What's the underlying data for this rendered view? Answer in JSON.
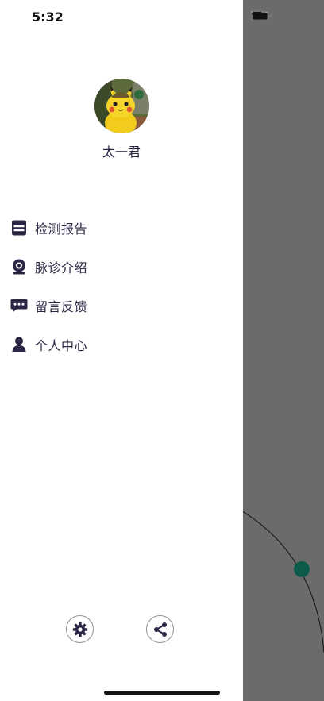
{
  "status_bar": {
    "time": "5:32"
  },
  "profile": {
    "username": "太一君",
    "avatar_icon": "pikachu-avatar"
  },
  "menu": {
    "items": [
      {
        "label": "检测报告",
        "icon": "report-icon"
      },
      {
        "label": "脉诊介绍",
        "icon": "webcam-icon"
      },
      {
        "label": "留言反馈",
        "icon": "message-icon"
      },
      {
        "label": "个人中心",
        "icon": "user-icon"
      }
    ]
  },
  "bottom_actions": [
    {
      "icon": "settings-icon"
    },
    {
      "icon": "share-icon"
    }
  ],
  "colors": {
    "text": "#2b2645",
    "overlay": "#6b6b6b",
    "accent_dot": "#0d5c4b"
  }
}
